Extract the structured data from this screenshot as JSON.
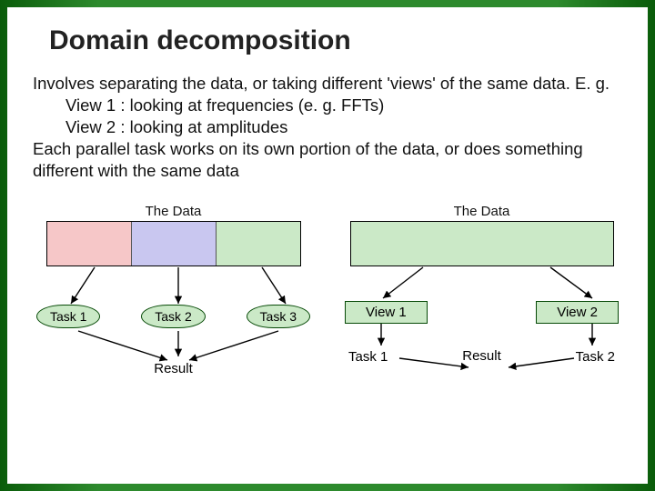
{
  "title": "Domain decomposition",
  "body": {
    "line1": "Involves separating the data, or taking different 'views' of the same data. E. g.",
    "view1line": "View 1 : looking at frequencies (e. g. FFTs)",
    "view2line": "View 2 : looking at amplitudes",
    "line2": "Each parallel task works on its own portion of the data, or does something different with the same data"
  },
  "left": {
    "label": "The Data",
    "task1": "Task 1",
    "task2": "Task 2",
    "task3": "Task 3",
    "result": "Result"
  },
  "right": {
    "label": "The Data",
    "view1": "View 1",
    "view2": "View 2",
    "task1": "Task 1",
    "task2": "Task 2",
    "result": "Result"
  },
  "colors": {
    "seg_red": "#f6c7c8",
    "seg_blue": "#c9c7f0",
    "seg_green": "#cbe9c7",
    "border_dark": "#074a07"
  }
}
